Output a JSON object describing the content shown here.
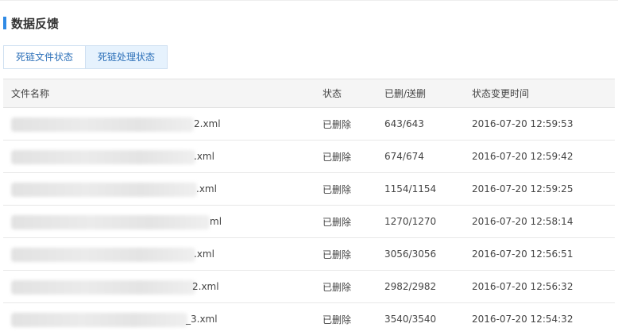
{
  "section": {
    "title": "数据反馈"
  },
  "tabs": [
    {
      "label": "死链文件状态",
      "active": false
    },
    {
      "label": "死链处理状态",
      "active": true
    }
  ],
  "table": {
    "headers": [
      "文件名称",
      "状态",
      "已删/送删",
      "状态变更时间"
    ],
    "rows": [
      {
        "file": "2.xml",
        "status": "已删除",
        "count": "643/643",
        "time": "2016-07-20 12:59:53"
      },
      {
        "file": ".xml",
        "status": "已删除",
        "count": "674/674",
        "time": "2016-07-20 12:59:42"
      },
      {
        "file": ".xml",
        "status": "已删除",
        "count": "1154/1154",
        "time": "2016-07-20 12:59:25"
      },
      {
        "file": "ml",
        "status": "已删除",
        "count": "1270/1270",
        "time": "2016-07-20 12:58:14"
      },
      {
        "file": ".xml",
        "status": "已删除",
        "count": "3056/3056",
        "time": "2016-07-20 12:56:51"
      },
      {
        "file": "2.xml",
        "status": "已删除",
        "count": "2982/2982",
        "time": "2016-07-20 12:56:32"
      },
      {
        "file": "_3.xml",
        "status": "已删除",
        "count": "3540/3540",
        "time": "2016-07-20 12:54:32"
      }
    ]
  },
  "colors": {
    "accent": "#2f8ae5",
    "tab_active_bg": "#e6f2fd",
    "header_bg": "#f5f5f5"
  }
}
